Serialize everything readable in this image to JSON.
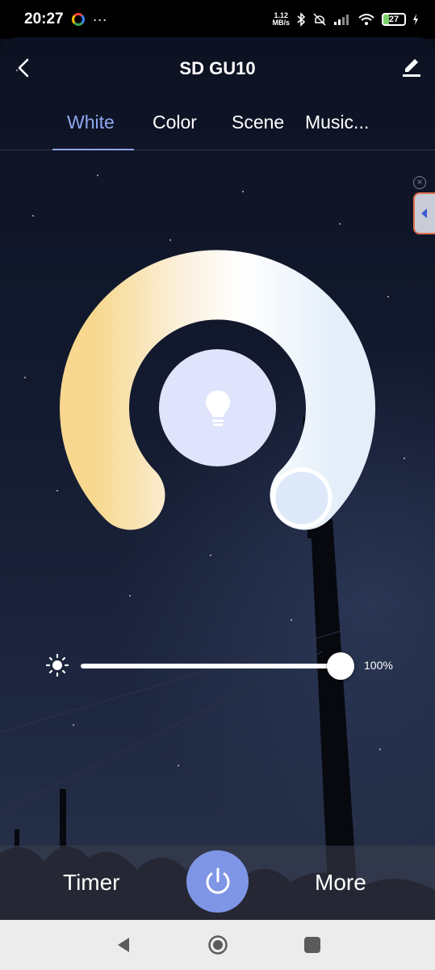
{
  "status_bar": {
    "time": "20:27",
    "overflow": "···",
    "net_speed_value": "1.12",
    "net_speed_unit": "MB/s",
    "battery": "27"
  },
  "header": {
    "title": "SD GU10",
    "back_icon": "chevron-left-icon",
    "edit_icon": "pencil-icon"
  },
  "tabs": [
    {
      "label": "White",
      "active": true
    },
    {
      "label": "Color",
      "active": false
    },
    {
      "label": "Scene",
      "active": false
    },
    {
      "label": "Music...",
      "active": false
    }
  ],
  "color_wheel": {
    "warm_color": "#f7d88e",
    "cool_color": "#e6f0fa",
    "center_color": "#dfe3fb",
    "selected": "cool"
  },
  "brightness": {
    "value_label": "100%",
    "percent": 100
  },
  "bottom": {
    "timer_label": "Timer",
    "more_label": "More",
    "power_color": "#7f95e6"
  },
  "nav": {
    "back_icon": "triangle-back-icon",
    "home_icon": "circle-home-icon",
    "recents_icon": "square-recents-icon"
  }
}
